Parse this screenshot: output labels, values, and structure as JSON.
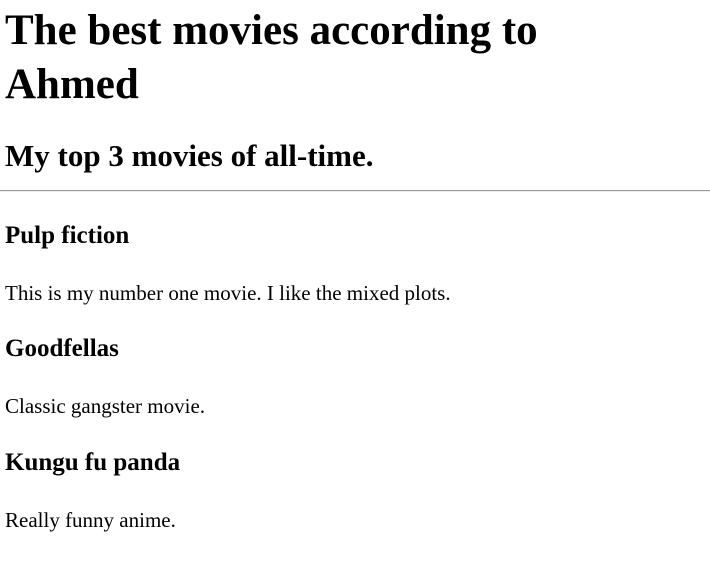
{
  "page": {
    "title": "The best movies according to Ahmed",
    "subtitle": "My top 3 movies of all-time."
  },
  "movies": [
    {
      "name": "Pulp fiction",
      "description": "This is my number one movie. I like the mixed plots."
    },
    {
      "name": "Goodfellas",
      "description": "Classic gangster movie."
    },
    {
      "name": "Kungu fu panda",
      "description": "Really funny anime."
    }
  ]
}
